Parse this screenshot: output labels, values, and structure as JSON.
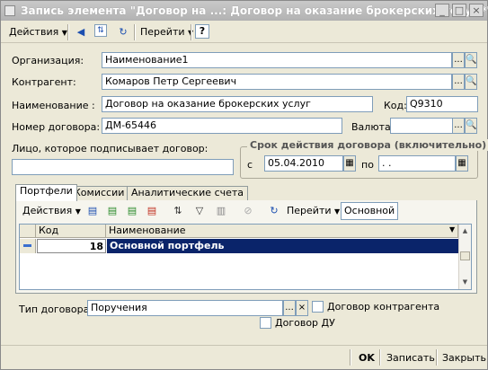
{
  "window": {
    "title": "Запись элемента \"Договор на ...: Договор на оказание брокерских услуг *\"",
    "controls": [
      "_",
      "□",
      "×"
    ]
  },
  "toolbar": {
    "actions_label": "Действия",
    "goto_label": "Перейти",
    "help_label": "?"
  },
  "form": {
    "org_label": "Организация:",
    "org_value": "Наименование1",
    "contragent_label": "Контрагент:",
    "contragent_value": "Комаров Петр Сергеевич",
    "name_label": "Наименование :",
    "name_value": "Договор на оказание брокерских услуг",
    "code_label": "Код:",
    "code_value": "Q9310",
    "contract_num_label": "Номер договора:",
    "contract_num_value": "ДМ-65446",
    "currency_label": "Валюта:",
    "currency_value": "",
    "signer_label": "Лицо, которое подписывает договор:",
    "signer_value": "",
    "term_title": "Срок действия договора (включительно)",
    "from_label": "с",
    "from_value": "05.04.2010",
    "to_label": "по",
    "to_value": " .  ."
  },
  "tabs": [
    "Портфели",
    "Комиссии",
    "Аналитические счета"
  ],
  "tab_toolbar": {
    "actions_label": "Действия",
    "goto_label": "Перейти",
    "main_label": "Основной"
  },
  "grid": {
    "headers": [
      "Код",
      "Наименование"
    ],
    "rows": [
      {
        "code": "18",
        "name": "Основной портфель"
      }
    ]
  },
  "lower": {
    "contract_type_label": "Тип договора:",
    "contract_type_value": "Поручения",
    "contragent_contract_label": "Договор контрагента",
    "du_contract_label": "Договор ДУ"
  },
  "buttons": {
    "ok": "OK",
    "save": "Записать",
    "close": "Закрыть"
  }
}
